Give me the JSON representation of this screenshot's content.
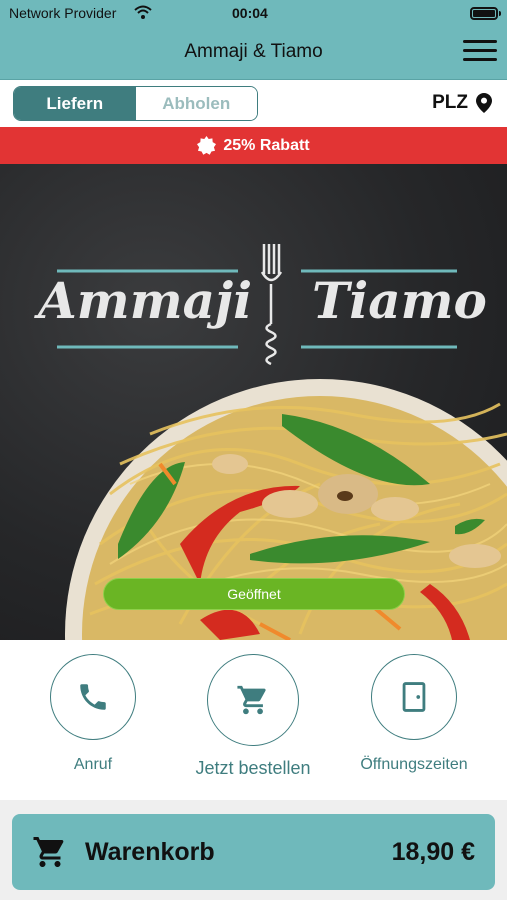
{
  "statusbar": {
    "provider": "Network Provider",
    "time": "00:04"
  },
  "header": {
    "title": "Ammaji & Tiamo"
  },
  "mode": {
    "delivery": "Liefern",
    "pickup": "Abholen",
    "selected": "Liefern"
  },
  "postcode": {
    "label": "PLZ"
  },
  "discount": {
    "text": "25% Rabatt"
  },
  "hero": {
    "logo_left": "Ammaji",
    "logo_right": "Tiamo",
    "status": "Geöffnet"
  },
  "actions": [
    {
      "label": "Anruf",
      "icon": "phone-icon"
    },
    {
      "label": "Jetzt bestellen",
      "icon": "cart-icon"
    },
    {
      "label": "Öffnungszeiten",
      "icon": "door-icon"
    }
  ],
  "cart": {
    "label": "Warenkorb",
    "total": "18,90 €",
    "icon": "cart-icon"
  },
  "colors": {
    "primary": "#6fb9bb",
    "dark_teal": "#3f7d7f",
    "discount_red": "#e23434",
    "open_green": "#6ab524"
  }
}
